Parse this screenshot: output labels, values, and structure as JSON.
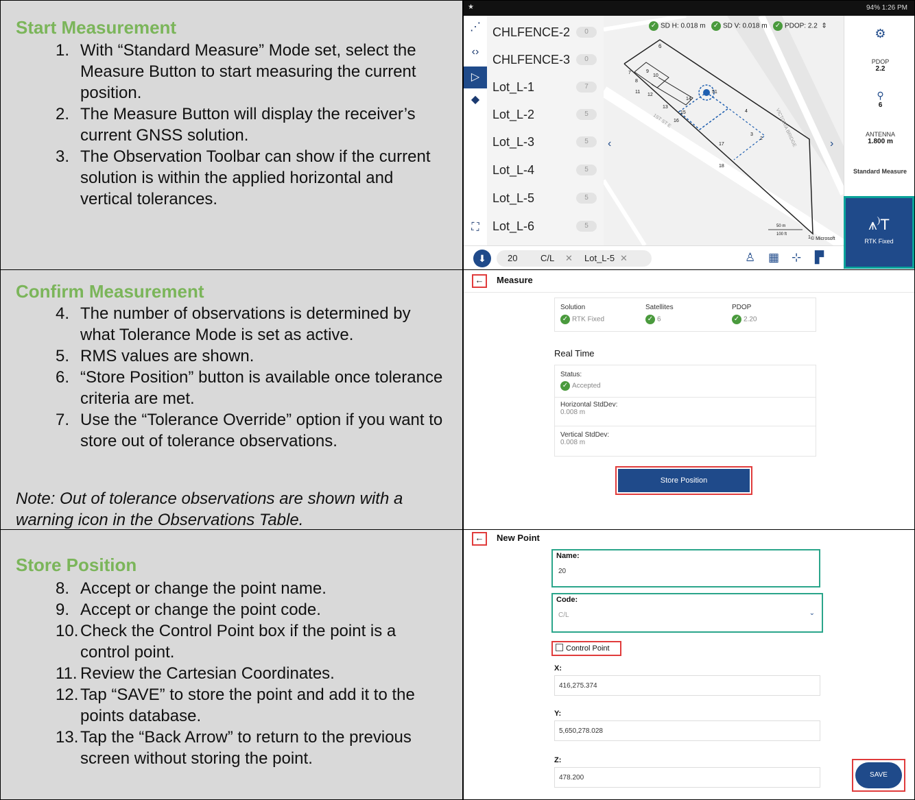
{
  "sections": [
    {
      "title": "Start Measurement",
      "items": [
        {
          "num": "1.",
          "text": "With “Standard Measure” Mode set, select the Measure Button to start measuring the current position."
        },
        {
          "num": "2.",
          "text": "The Measure Button will display the receiver’s current GNSS solution."
        },
        {
          "num": "3.",
          "text": "The Observation Toolbar can show if the current solution is within the applied horizontal and vertical tolerances."
        }
      ]
    },
    {
      "title": "Confirm Measurement",
      "items": [
        {
          "num": "4.",
          "text": "The number of observations is determined by what Tolerance Mode is set as active."
        },
        {
          "num": "5.",
          "text": "RMS values are shown."
        },
        {
          "num": "6.",
          "text": "“Store Position” button is available once tolerance criteria are met."
        },
        {
          "num": "7.",
          "text": "Use the “Tolerance Override” option if you want to store out of tolerance observations."
        }
      ],
      "note": "Note: Out of tolerance observations are shown with a warning icon in the Observations Table."
    },
    {
      "title": "Store Position",
      "items": [
        {
          "num": "8.",
          "text": "Accept or change the point name."
        },
        {
          "num": "9.",
          "text": "Accept or change the point code."
        },
        {
          "num": "10.",
          "text": "Check the Control Point box if the point is a control point."
        },
        {
          "num": "11.",
          "text": "Review the Cartesian Coordinates."
        },
        {
          "num": "12.",
          "text": "Tap “SAVE” to store the point and add it to the points database."
        },
        {
          "num": "13.",
          "text": "Tap the “Back Arrow” to return to the previous screen without storing the point."
        }
      ]
    }
  ],
  "screen1": {
    "status_time": "94% 1:26 PM",
    "points": [
      {
        "name": "CHLFENCE-2",
        "count": "0"
      },
      {
        "name": "CHLFENCE-3",
        "count": "0"
      },
      {
        "name": "Lot_L-1",
        "count": "7"
      },
      {
        "name": "Lot_L-2",
        "count": "5"
      },
      {
        "name": "Lot_L-3",
        "count": "5"
      },
      {
        "name": "Lot_L-4",
        "count": "5"
      },
      {
        "name": "Lot_L-5",
        "count": "5"
      },
      {
        "name": "Lot_L-6",
        "count": "5"
      }
    ],
    "obs": {
      "sdh": "SD H: 0.018 m",
      "sdv": "SD V: 0.018 m",
      "pdop": "PDOP: 2.2"
    },
    "right": {
      "pdop_label": "PDOP",
      "pdop_val": "2.2",
      "sats_val": "6",
      "antenna_label": "ANTENNA",
      "antenna_val": "1.800 m",
      "mode": "Standard Measure",
      "rtk": "RTK Fixed"
    },
    "chips": {
      "point": "20",
      "code": "C/L",
      "line": "Lot_L-5"
    },
    "map_labels": {
      "attribution": "© Microsoft",
      "scale_m": "50 m",
      "scale_ft": "100 ft",
      "street": "1ST ST E",
      "street2": "VICTORIA BRIDGE"
    },
    "map_points": [
      "6",
      "7",
      "8",
      "9",
      "10",
      "11",
      "12",
      "13",
      "14",
      "15",
      "16",
      "17",
      "18",
      "3",
      "2",
      "4",
      "51",
      "1"
    ]
  },
  "screen2": {
    "title": "Measure",
    "solution_label": "Solution",
    "solution_val": "RTK Fixed",
    "sats_label": "Satellites",
    "sats_val": "6",
    "pdop_label": "PDOP",
    "pdop_val": "2.20",
    "realtime": "Real Time",
    "status_label": "Status:",
    "status_val": "Accepted",
    "h_label": "Horizontal StdDev:",
    "h_val": "0.008 m",
    "v_label": "Vertical StdDev:",
    "v_val": "0.008 m",
    "store": "Store Position"
  },
  "screen3": {
    "title": "New Point",
    "name_label": "Name:",
    "name_val": "20",
    "code_label": "Code:",
    "code_val": "C/L",
    "control_label": "Control Point",
    "x_label": "X:",
    "x_val": "416,275.374",
    "y_label": "Y:",
    "y_val": "5,650,278.028",
    "z_label": "Z:",
    "z_val": "478.200",
    "save": "SAVE"
  }
}
